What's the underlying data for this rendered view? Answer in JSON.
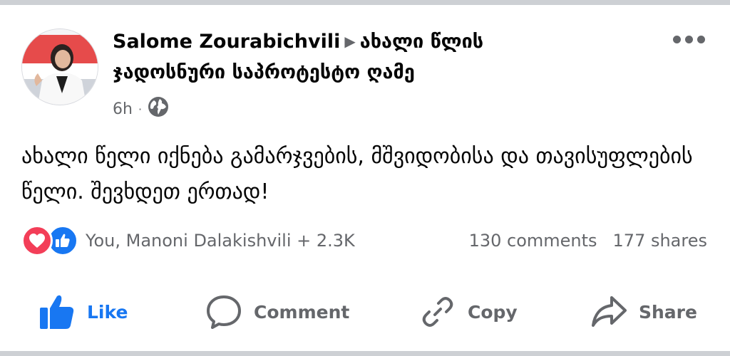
{
  "post": {
    "author": "Salome Zourabichvili",
    "target": "ახალი წლის ჯადოსნური საპროტესტო ღამე",
    "time": "6h",
    "audience_icon": "globe-icon",
    "text": "ახალი წელი იქნება გამარჯვების, მშვიდობისა და თავისუფლების წელი. შევხდეთ ერთად!"
  },
  "reactions": {
    "icons": [
      "love-reaction-icon",
      "like-reaction-icon"
    ],
    "summary": "You, Manoni Dalakishvili + 2.3K",
    "comments": "130 comments",
    "shares": "177 shares"
  },
  "actions": {
    "like": "Like",
    "comment": "Comment",
    "copy": "Copy",
    "share": "Share"
  },
  "colors": {
    "accent": "#1877f2",
    "love": "#f33e58",
    "muted": "#65676b",
    "separator": "#cdd0d4"
  }
}
